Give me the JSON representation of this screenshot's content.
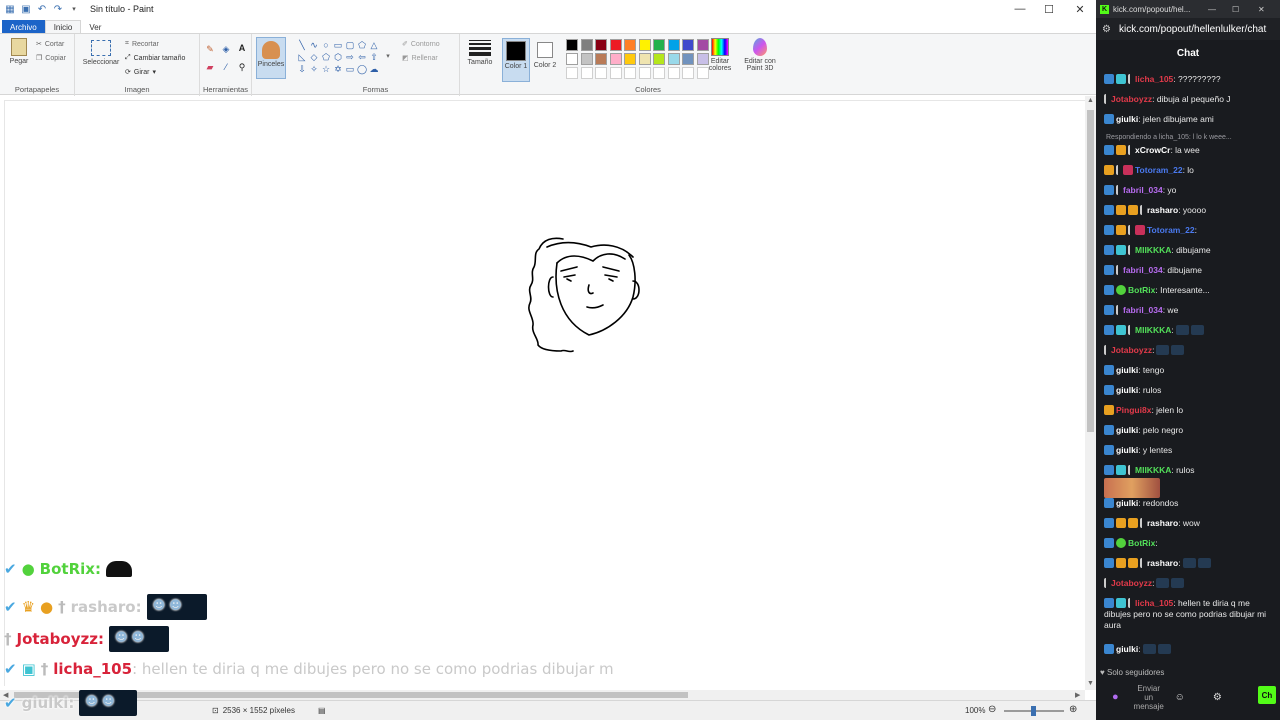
{
  "paint": {
    "title": "Sin título - Paint",
    "tabs": [
      "Archivo",
      "Inicio",
      "Ver"
    ],
    "groups": {
      "clipboard": {
        "label": "Portapapeles",
        "paste": "Pegar",
        "cut": "Cortar",
        "copy": "Copiar"
      },
      "image": {
        "label": "Imagen",
        "select": "Seleccionar",
        "crop": "Recortar",
        "resize": "Cambiar tamaño",
        "rotate": "Girar"
      },
      "tools": {
        "label": "Herramientas"
      },
      "brushes": {
        "label": "Pinceles"
      },
      "shapes": {
        "label": "Formas",
        "outline": "Contorno",
        "fill": "Rellenar"
      },
      "size": {
        "label": "Tamaño"
      },
      "color1": {
        "label": "Color 1"
      },
      "color2": {
        "label": "Color 2"
      },
      "colors": {
        "label": "Colores",
        "edit": "Editar colores"
      },
      "paint3d": {
        "label": "Editar con Paint 3D"
      }
    },
    "palette": [
      "#000000",
      "#7f7f7f",
      "#880015",
      "#ed1c24",
      "#ff7f27",
      "#fff200",
      "#22b14c",
      "#00a2e8",
      "#3f48cc",
      "#a349a4",
      "#ffffff",
      "#c3c3c3",
      "#b97a57",
      "#ffaec9",
      "#ffc90e",
      "#efe4b0",
      "#b5e61d",
      "#99d9ea",
      "#7092be",
      "#c8bfe7"
    ],
    "status": {
      "dimensions": "2536 × 1552 píxeles",
      "zoom": "100%"
    }
  },
  "overlay": {
    "lines": [
      {
        "user": "BotRix",
        "text": ":",
        "color": "#52d23c"
      },
      {
        "user": "rasharo",
        "text": ":",
        "color": "#c9c9c9"
      },
      {
        "user": "Jotaboyzz",
        "text": ":",
        "color": "#d8233a"
      },
      {
        "user": "licha_105",
        "text": ": hellen te diria q me dibujes pero no se como podrias dibujar m",
        "color": "#d8233a"
      },
      {
        "user": "giulki",
        "text": ":",
        "color": "#c9c9c9"
      }
    ]
  },
  "chat": {
    "tab_title": "kick.com/popout/hel...",
    "url": "kick.com/popout/hellenlulker/chat",
    "header": "Chat",
    "messages": [
      {
        "user": "licha_105",
        "color": "#e23a4a",
        "text": ": ?????????"
      },
      {
        "user": "Jotaboyzz",
        "color": "#e23a4a",
        "text": ": dibuja al pequeño J"
      },
      {
        "user": "giulki",
        "color": "#ffffff",
        "text": ": jelen dibujame ami"
      },
      {
        "user": "xCrowCr",
        "color": "#ffffff",
        "text": ": la wee",
        "reply": "Respondiendo a licha_105: l lo k weee..."
      },
      {
        "user": "Totoram_22",
        "color": "#4a7af0",
        "text": ": lo"
      },
      {
        "user": "fabril_034",
        "color": "#b86cf0",
        "text": ": yo"
      },
      {
        "user": "rasharo",
        "color": "#ffffff",
        "text": ": yoooo"
      },
      {
        "user": "Totoram_22",
        "color": "#4a7af0",
        "text": ":"
      },
      {
        "user": "MIIKKKA",
        "color": "#53e05a",
        "text": ": dibujame"
      },
      {
        "user": "fabril_034",
        "color": "#b86cf0",
        "text": ": dibujame"
      },
      {
        "user": "BotRix",
        "color": "#53e05a",
        "text": ": Interesante..."
      },
      {
        "user": "fabril_034",
        "color": "#b86cf0",
        "text": ": we"
      },
      {
        "user": "MIIKKKA",
        "color": "#53e05a",
        "text": ":"
      },
      {
        "user": "Jotaboyzz",
        "color": "#e23a4a",
        "text": ":"
      },
      {
        "user": "giulki",
        "color": "#ffffff",
        "text": ": tengo"
      },
      {
        "user": "giulki",
        "color": "#ffffff",
        "text": ": rulos"
      },
      {
        "user": "Pingui8x",
        "color": "#e23a4a",
        "text": ": jelen lo"
      },
      {
        "user": "giulki",
        "color": "#ffffff",
        "text": ": pelo negro"
      },
      {
        "user": "giulki",
        "color": "#ffffff",
        "text": ": y lentes"
      },
      {
        "user": "MIIKKKA",
        "color": "#53e05a",
        "text": ": rulos"
      },
      {
        "user": "giulki",
        "color": "#ffffff",
        "text": ": redondos"
      },
      {
        "user": "rasharo",
        "color": "#ffffff",
        "text": ": wow"
      },
      {
        "user": "BotRix",
        "color": "#53e05a",
        "text": ":"
      },
      {
        "user": "rasharo",
        "color": "#ffffff",
        "text": ":"
      },
      {
        "user": "Jotaboyzz",
        "color": "#e23a4a",
        "text": ":"
      },
      {
        "user": "licha_105",
        "color": "#e23a4a",
        "text": ": hellen te diria q me dibujes pero no se como podrias dibujar mi aura"
      },
      {
        "user": "giulki",
        "color": "#ffffff",
        "text": ":"
      }
    ],
    "followers_only": "Solo seguidores",
    "send_placeholder": "Enviar un mensaje",
    "send_button": "Ch"
  }
}
